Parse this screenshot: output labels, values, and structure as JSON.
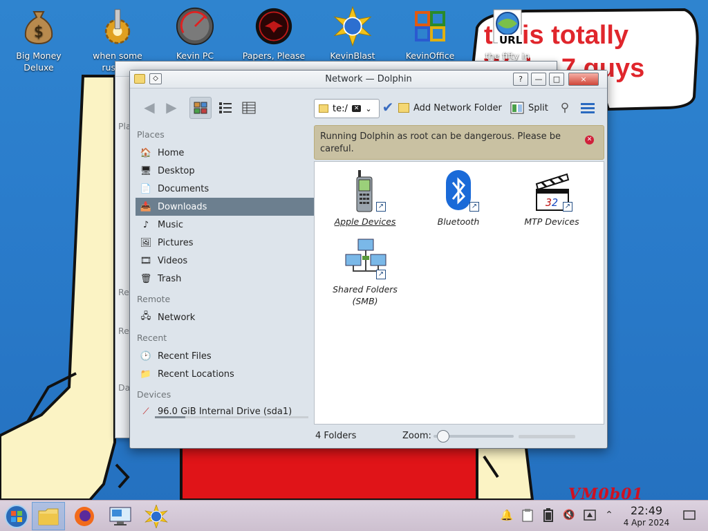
{
  "desktop": {
    "icons": [
      {
        "label": "Big Money Deluxe",
        "icon": "money-bag-icon"
      },
      {
        "label": "when some russian",
        "icon": "gear-icon"
      },
      {
        "label": "Kevin PC",
        "icon": "speedometer-icon"
      },
      {
        "label": "Papers, Please",
        "icon": "red-seal-icon"
      },
      {
        "label": "KevinBlast",
        "icon": "globe-burst-icon"
      },
      {
        "label": "KevinOffice",
        "icon": "office-icon"
      },
      {
        "label": "the fifty in",
        "icon": "url-globe-icon"
      }
    ],
    "url_badge": "URL",
    "speech_line1": "t   s is totally",
    "speech_line2": "W    d    s   7 guys",
    "signature": "VM0b01"
  },
  "background_window": {
    "sidebar_fragments": [
      "Pla",
      "Re",
      "Re",
      "Da"
    ]
  },
  "window": {
    "title": "Network — Dolphin",
    "buttons": {
      "help": "?",
      "minimize": "—",
      "maximize": "□",
      "close": "×"
    },
    "toolbar": {
      "location": "te:/",
      "add_network_folder": "Add Network Folder",
      "split": "Split"
    },
    "sidebar": {
      "places_heading": "Places",
      "places": [
        {
          "label": "Home",
          "icon": "home-folder-icon"
        },
        {
          "label": "Desktop",
          "icon": "desktop-folder-icon"
        },
        {
          "label": "Documents",
          "icon": "documents-folder-icon"
        },
        {
          "label": "Downloads",
          "icon": "downloads-folder-icon"
        },
        {
          "label": "Music",
          "icon": "music-folder-icon"
        },
        {
          "label": "Pictures",
          "icon": "pictures-folder-icon"
        },
        {
          "label": "Videos",
          "icon": "videos-folder-icon"
        },
        {
          "label": "Trash",
          "icon": "trash-icon"
        }
      ],
      "selected_place": "Downloads",
      "remote_heading": "Remote",
      "remote": [
        {
          "label": "Network",
          "icon": "network-folder-icon"
        }
      ],
      "recent_heading": "Recent",
      "recent": [
        {
          "label": "Recent Files",
          "icon": "recent-files-icon"
        },
        {
          "label": "Recent Locations",
          "icon": "recent-locations-icon"
        }
      ],
      "devices_heading": "Devices",
      "devices": [
        {
          "label": "96.0 GiB Internal Drive (sda1)",
          "icon": "drive-icon",
          "usage": 0.2
        }
      ]
    },
    "warning": {
      "text": "Running Dolphin as root can be dangerous. Please be careful."
    },
    "items": [
      {
        "label": "Apple Devices",
        "icon": "mobile-phone-icon"
      },
      {
        "label": "Bluetooth",
        "icon": "bluetooth-icon"
      },
      {
        "label": "MTP Devices",
        "icon": "clapperboard-icon"
      },
      {
        "label": "Shared Folders (SMB)",
        "icon": "network-computers-icon"
      }
    ],
    "status": {
      "count": "4 Folders",
      "zoom_label": "Zoom:",
      "zoom_level": 0.05
    }
  },
  "taskbar": {
    "apps": [
      "start-orb-icon",
      "file-manager-icon",
      "firefox-icon",
      "remote-desktop-icon",
      "kevinblast-icon"
    ],
    "tray": [
      "notifications-icon",
      "clipboard-icon",
      "volume-muted-icon",
      "keyboard-icon",
      "chevron-up-icon"
    ],
    "time": "22:49",
    "date": "4 Apr 2024"
  }
}
